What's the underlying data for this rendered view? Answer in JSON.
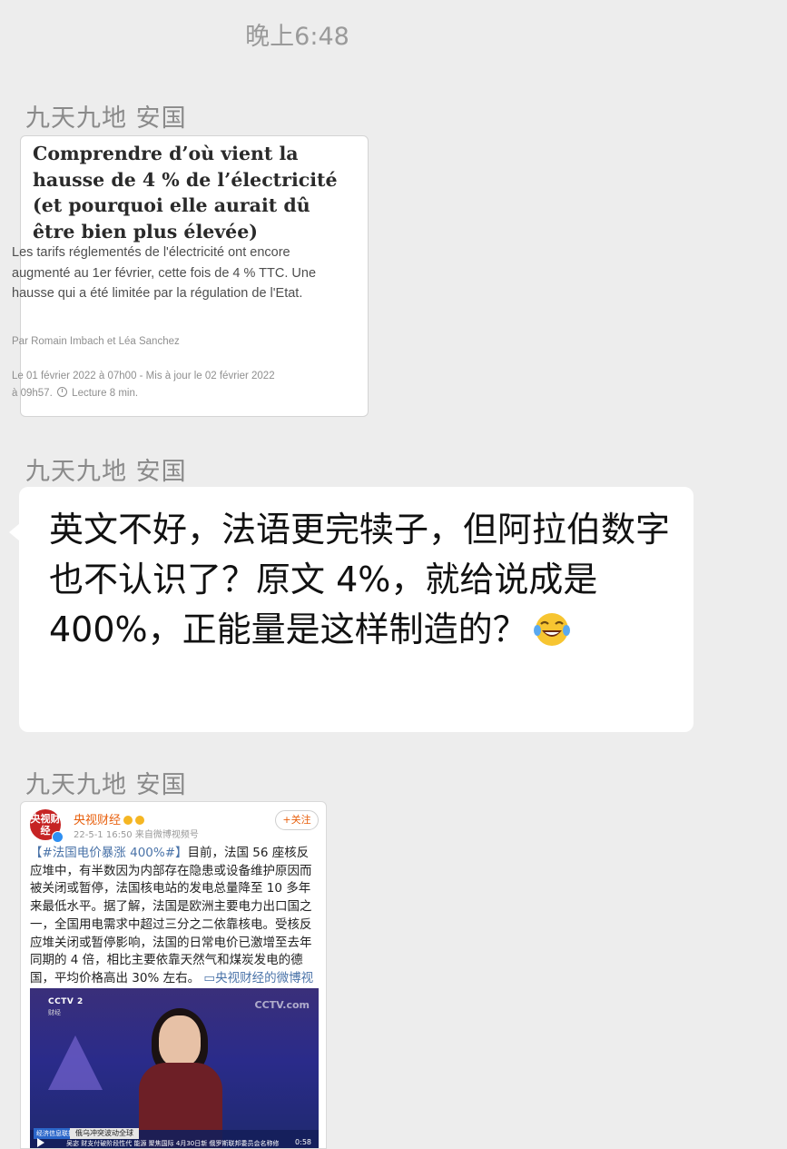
{
  "chat": {
    "timestamp": "晚上6:48",
    "messages": [
      {
        "sender": "九天九地 安国",
        "type": "image",
        "article": {
          "headline_lines": [
            "Comprendre d’où vient la",
            "hausse de 4 % de l’électricité",
            "(et pourquoi elle aurait dû",
            "être bien plus élevée)"
          ],
          "lede": "Les tarifs réglementés de l'électricité ont encore augmenté au 1er février, cette fois de 4 % TTC. Une hausse qui a été limitée par la régulation de l'Etat.",
          "byline": "Par Romain Imbach et Léa Sanchez",
          "date_line1": "Le 01 février 2022 à 07h00 - Mis à jour le 02 février 2022",
          "date_line2a": "à 09h57.",
          "date_line2b": "Lecture 8 min."
        }
      },
      {
        "sender": "九天九地 安国",
        "type": "text",
        "text": "英文不好，法语更完犊子，但阿拉伯数字也不认识了？原文 4%，就给说成是 400%，正能量是这样制造的？",
        "emoji": "laugh-with-tears-icon"
      },
      {
        "sender": "九天九地 安国",
        "type": "image",
        "weibo": {
          "avatar_text": "央视财经",
          "account_name": "央视财经",
          "meta": "22-5-1 16:50  来自微博视频号",
          "follow_label": "+关注",
          "hashtag": "【#法国电价暴涨 400%#】",
          "body": "目前，法国 56 座核反应堆中，有半数因为内部存在隐患或设备维护原因而被关闭或暂停，法国核电站的发电总量降至 10 多年来最低水平。据了解，法国是欧洲主要电力出口国之一，全国用电需求中超过三分之二依靠核电。受核反应堆关闭或暂停影响，法国的日常电价已激增至去年同期的 4 倍，相比主要依靠天然气和煤炭发电的德国，平均价格高出 30% 左右。",
          "video_link": "央视财经的微博视频",
          "video": {
            "channel_logo": "CCTV 2",
            "channel_sub": "财经",
            "watermark": "CCTV.com",
            "ticker_tag": "经济信息联播",
            "ticker_title": "俄乌冲突波动全球",
            "ticker_text": "吴宓   财支付破阶段性代   能源   聚焦国际 4月30日新   俄罗斯联邦委员会名称修",
            "duration": "0:58"
          }
        }
      }
    ]
  }
}
